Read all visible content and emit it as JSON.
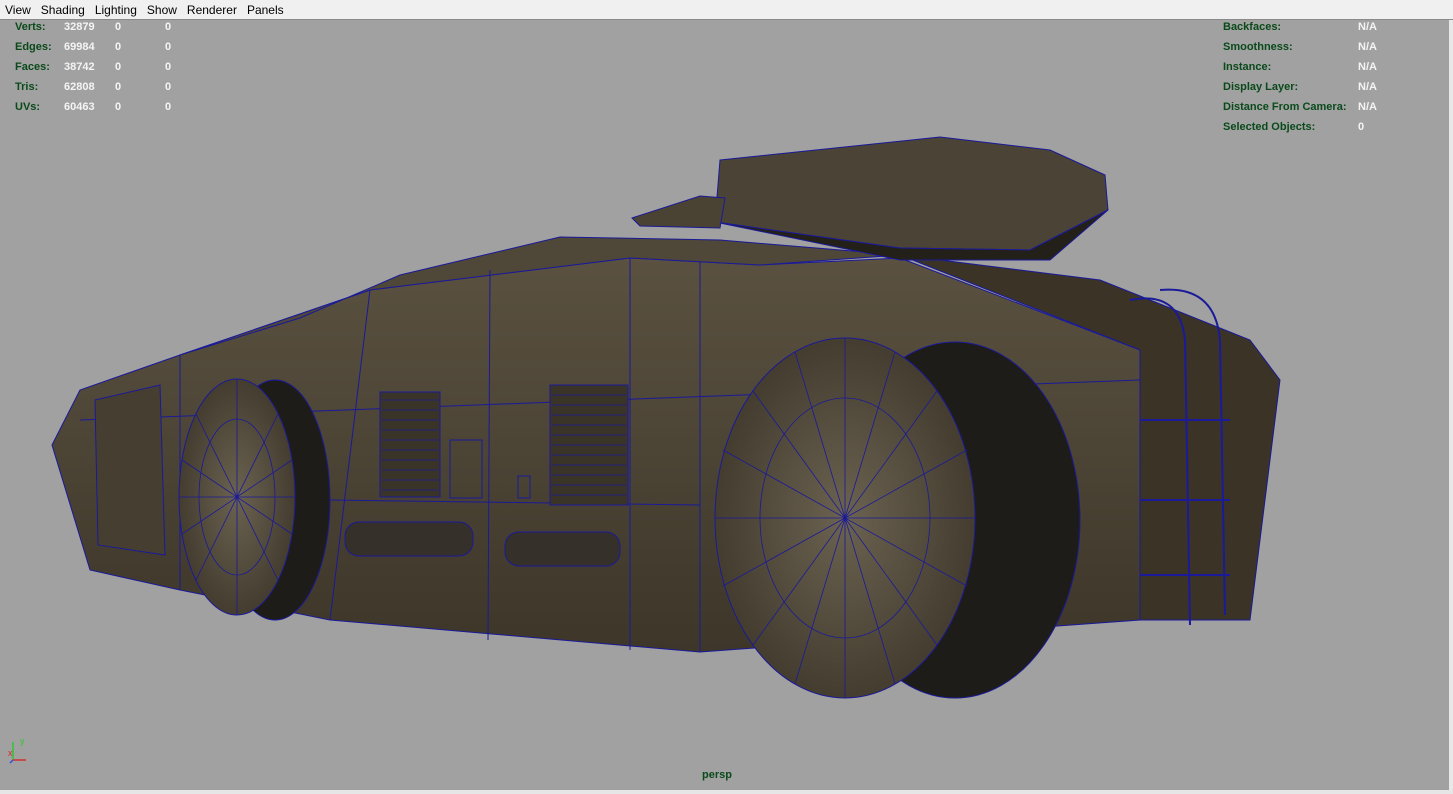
{
  "menu": {
    "items": [
      "View",
      "Shading",
      "Lighting",
      "Show",
      "Renderer",
      "Panels"
    ]
  },
  "stats": [
    {
      "label": "Verts:",
      "values": [
        "32879",
        "0",
        "0"
      ]
    },
    {
      "label": "Edges:",
      "values": [
        "69984",
        "0",
        "0"
      ]
    },
    {
      "label": "Faces:",
      "values": [
        "38742",
        "0",
        "0"
      ]
    },
    {
      "label": "Tris:",
      "values": [
        "62808",
        "0",
        "0"
      ]
    },
    {
      "label": "UVs:",
      "values": [
        "60463",
        "0",
        "0"
      ]
    }
  ],
  "info": [
    {
      "label": "Backfaces:",
      "value": "N/A"
    },
    {
      "label": "Smoothness:",
      "value": "N/A"
    },
    {
      "label": "Instance:",
      "value": "N/A"
    },
    {
      "label": "Display Layer:",
      "value": "N/A"
    },
    {
      "label": "Distance From Camera:",
      "value": "N/A"
    },
    {
      "label": "Selected Objects:",
      "value": "0"
    }
  ],
  "camera": "persp",
  "axis": {
    "y": "y",
    "x": "x"
  },
  "colors": {
    "viewport_bg": "#a1a1a1",
    "hud_label": "#0a4a1a",
    "hud_value": "#f4f4f4",
    "wireframe": "#1a1a9a",
    "vehicle_body": "#4a4133"
  }
}
